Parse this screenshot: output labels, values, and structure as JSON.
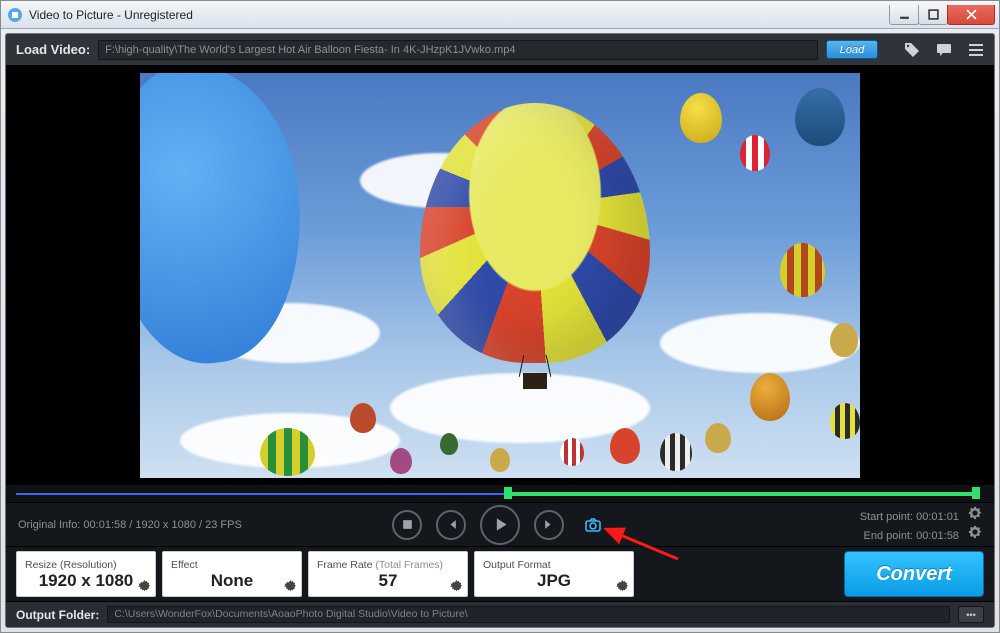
{
  "window": {
    "title": "Video to Picture - Unregistered"
  },
  "topbar": {
    "load_label": "Load Video:",
    "path": "F:\\high-quality\\The World's Largest Hot Air Balloon Fiesta- In 4K-JHzpK1JVwko.mp4",
    "load_button": "Load"
  },
  "original_info": "Original Info: 00:01:58 / 1920 x 1080 / 23 FPS",
  "points": {
    "start_label": "Start point: ",
    "start_value": "00:01:01",
    "end_label": "End point: ",
    "end_value": "00:01:58"
  },
  "panels": {
    "resize": {
      "label": "Resize (Resolution)",
      "value": "1920 x 1080"
    },
    "effect": {
      "label": "Effect",
      "value": "None"
    },
    "frame": {
      "label": "Frame Rate ",
      "sublabel": "(Total Frames)",
      "value": "57"
    },
    "format": {
      "label": "Output Format",
      "value": "JPG"
    }
  },
  "convert_label": "Convert",
  "output": {
    "label": "Output Folder:",
    "path": "C:\\Users\\WonderFox\\Documents\\AoaoPhoto Digital Studio\\Video to Picture\\",
    "browse": "•••"
  }
}
